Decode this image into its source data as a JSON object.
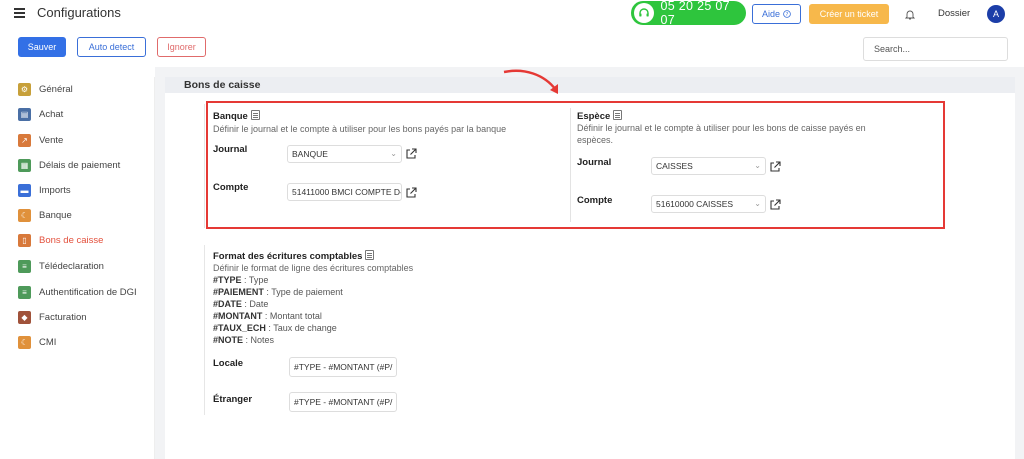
{
  "header": {
    "title": "Configurations",
    "phone": "05 20 25 07 07",
    "help_label": "Aide",
    "ticket_label": "Créer un ticket",
    "dossier_label": "Dossier",
    "avatar_letter": "A"
  },
  "toolbar": {
    "save_label": "Sauver",
    "auto_detect_label": "Auto detect",
    "ignore_label": "Ignorer",
    "search_placeholder": "Search..."
  },
  "sidebar": {
    "items": [
      {
        "label": "Général",
        "icon": "gear-icon",
        "color": "#c7a03a"
      },
      {
        "label": "Achat",
        "icon": "cart-icon",
        "color": "#4a6fa5"
      },
      {
        "label": "Vente",
        "icon": "chart-icon",
        "color": "#d8793b"
      },
      {
        "label": "Délais de paiement",
        "icon": "calendar-icon",
        "color": "#4e9a5a"
      },
      {
        "label": "Imports",
        "icon": "folder-icon",
        "color": "#3a6fd8"
      },
      {
        "label": "Banque",
        "icon": "moon-icon",
        "color": "#e0913b"
      },
      {
        "label": "Bons de caisse",
        "icon": "receipt-icon",
        "color": "#d8793b"
      },
      {
        "label": "Télédeclaration",
        "icon": "document-icon",
        "color": "#4e9a5a"
      },
      {
        "label": "Authentification de DGI",
        "icon": "document-icon",
        "color": "#4e9a5a"
      },
      {
        "label": "Facturation",
        "icon": "tag-icon",
        "color": "#a0523a"
      },
      {
        "label": "CMI",
        "icon": "moon-icon",
        "color": "#e0913b"
      }
    ],
    "active_index": 6
  },
  "section": {
    "title": "Bons de caisse"
  },
  "banque": {
    "title": "Banque",
    "description": "Définir le journal et le compte à utiliser pour les bons payés par la banque",
    "journal_label": "Journal",
    "journal_value": "BANQUE",
    "compte_label": "Compte",
    "compte_value": "51411000 BMCI COMPTE D-"
  },
  "espece": {
    "title": "Espèce",
    "description_line1": "Définir le journal et le compte à utiliser pour les bons de caisse payés en",
    "description_line2": "espèces.",
    "journal_label": "Journal",
    "journal_value": "CAISSES",
    "compte_label": "Compte",
    "compte_value": "51610000 CAISSES"
  },
  "format": {
    "title": "Format des écritures comptables",
    "description": "Définir le format de ligne des écritures comptables",
    "tokens": [
      {
        "key": "#TYPE",
        "value": "Type"
      },
      {
        "key": "#PAIEMENT",
        "value": "Type de paiement"
      },
      {
        "key": "#DATE",
        "value": "Date"
      },
      {
        "key": "#MONTANT",
        "value": "Montant total"
      },
      {
        "key": "#TAUX_ECH",
        "value": "Taux de change"
      },
      {
        "key": "#NOTE",
        "value": "Notes"
      }
    ],
    "locale_label": "Locale",
    "locale_value": "#TYPE - #MONTANT (#P/",
    "etranger_label": "Étranger",
    "etranger_value": "#TYPE - #MONTANT (#P/"
  }
}
